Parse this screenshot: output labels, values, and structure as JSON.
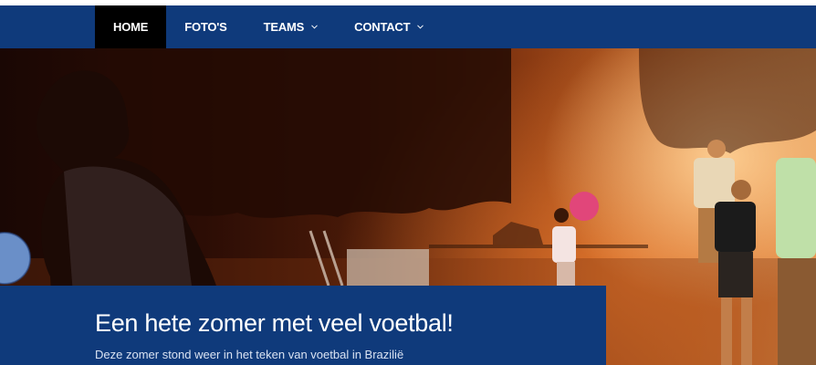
{
  "nav": {
    "items": [
      {
        "label": "HOME",
        "active": true,
        "dropdown": false
      },
      {
        "label": "FOTO'S",
        "active": false,
        "dropdown": false
      },
      {
        "label": "TEAMS",
        "active": false,
        "dropdown": true
      },
      {
        "label": "CONTACT",
        "active": false,
        "dropdown": true
      }
    ]
  },
  "hero": {
    "image": "kids playing football at sunset"
  },
  "caption": {
    "title": "Een hete zomer met veel voetbal!",
    "subtitle": "Deze zomer stond weer in het teken van voetbal in Brazilië"
  },
  "colors": {
    "nav_bg": "#0f3a7b",
    "nav_active": "#000000",
    "caption_bg": "#0f3a7b"
  }
}
